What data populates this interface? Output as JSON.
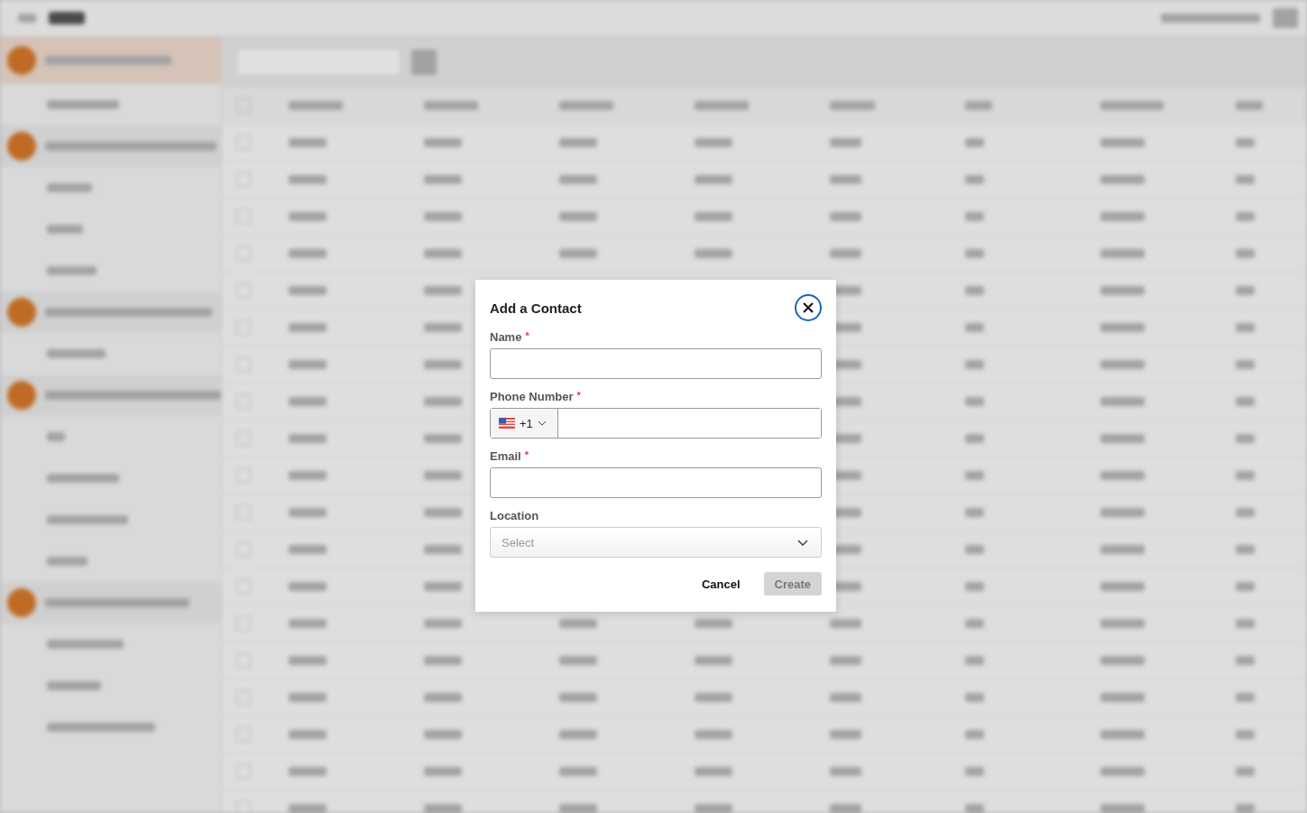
{
  "dialog": {
    "title": "Add a Contact",
    "fields": [
      {
        "kind": "text",
        "label": "Name",
        "required_mark": "*"
      },
      {
        "kind": "phone",
        "label": "Phone Number",
        "required_mark": "*",
        "country_code": "+1"
      },
      {
        "kind": "text",
        "label": "Email",
        "required_mark": "*"
      },
      {
        "kind": "select",
        "label": "Location",
        "placeholder": "Select"
      }
    ],
    "buttons": [
      {
        "kind": "text",
        "label": "Cancel",
        "disabled": false
      },
      {
        "kind": "primary",
        "label": "Create",
        "disabled": true
      }
    ]
  }
}
